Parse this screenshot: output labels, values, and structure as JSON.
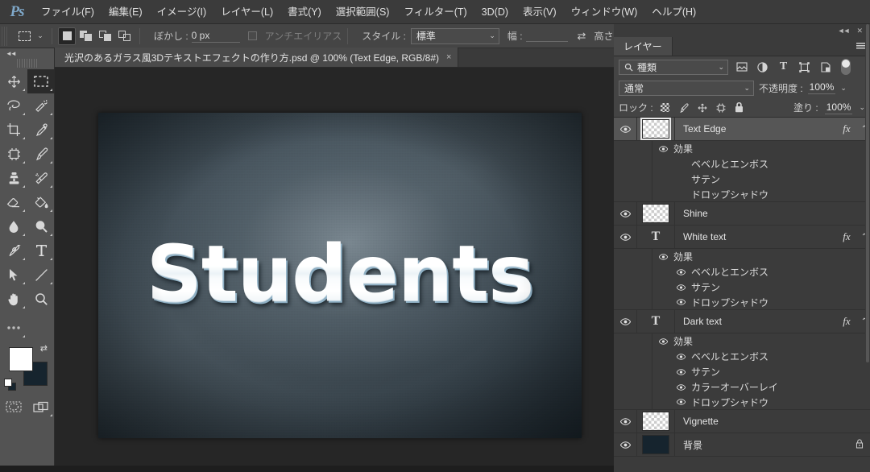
{
  "app": {
    "logo": "Ps"
  },
  "menubar": {
    "items": [
      {
        "label": "ファイル(F)"
      },
      {
        "label": "編集(E)"
      },
      {
        "label": "イメージ(I)"
      },
      {
        "label": "レイヤー(L)"
      },
      {
        "label": "書式(Y)"
      },
      {
        "label": "選択範囲(S)"
      },
      {
        "label": "フィルター(T)"
      },
      {
        "label": "3D(D)"
      },
      {
        "label": "表示(V)"
      },
      {
        "label": "ウィンドウ(W)"
      },
      {
        "label": "ヘルプ(H)"
      }
    ]
  },
  "options": {
    "tool_icon": "rectangular-marquee-icon",
    "feather_label": "ぼかし :",
    "feather_value": "0 px",
    "antialias_label": "アンチエイリアス",
    "antialias_checked": false,
    "style_label": "スタイル :",
    "style_value": "標準",
    "width_label": "幅 :",
    "width_value": "",
    "height_label": "高さ :",
    "height_value": "",
    "swap_icon": "swap-width-height-icon"
  },
  "document": {
    "tab_title": "光沢のあるガラス風3Dテキストエフェクトの作り方.psd @ 100% (Text Edge, RGB/8#)",
    "close_glyph": "×",
    "artwork_text": "Students"
  },
  "toolbar": {
    "tools": [
      {
        "name": "move-tool",
        "selected": false
      },
      {
        "name": "rectangular-marquee-tool",
        "selected": true
      },
      {
        "name": "lasso-tool",
        "selected": false
      },
      {
        "name": "quick-selection-tool",
        "selected": false
      },
      {
        "name": "crop-tool",
        "selected": false
      },
      {
        "name": "eyedropper-tool",
        "selected": false
      },
      {
        "name": "frame-tool",
        "selected": false
      },
      {
        "name": "brush-tool",
        "selected": false
      },
      {
        "name": "clone-stamp-tool",
        "selected": false
      },
      {
        "name": "healing-brush-tool",
        "selected": false
      },
      {
        "name": "eraser-tool",
        "selected": false
      },
      {
        "name": "paint-bucket-tool",
        "selected": false
      },
      {
        "name": "blur-tool",
        "selected": false
      },
      {
        "name": "dodge-tool",
        "selected": false
      },
      {
        "name": "pen-tool",
        "selected": false
      },
      {
        "name": "type-tool",
        "selected": false
      },
      {
        "name": "path-selection-tool",
        "selected": false
      },
      {
        "name": "line-tool",
        "selected": false
      },
      {
        "name": "hand-tool",
        "selected": false
      },
      {
        "name": "zoom-tool",
        "selected": false
      },
      {
        "name": "edit-toolbar-tool",
        "selected": false
      }
    ],
    "foreground_color": "#ffffff",
    "background_color": "#16242e",
    "quickmask_name": "quick-mask-mode",
    "screenmode_name": "screen-mode"
  },
  "panel": {
    "tab_label": "レイヤー",
    "collapse_glyph": "◄◄",
    "close_glyph": "✕",
    "filter": {
      "kind_label": "種類",
      "icons": [
        "pixel-filter-icon",
        "adjustment-filter-icon",
        "type-filter-icon",
        "shape-filter-icon",
        "smartobject-filter-icon"
      ],
      "toggle_name": "filter-enable-toggle"
    },
    "blend_mode": "通常",
    "opacity_label": "不透明度 :",
    "opacity_value": "100%",
    "lock_label": "ロック :",
    "lock_icons": [
      "lock-transparent-pixels-icon",
      "lock-image-pixels-icon",
      "lock-position-icon",
      "lock-artboard-nesting-icon",
      "lock-all-icon"
    ],
    "fill_label": "塗り :",
    "fill_value": "100%",
    "effects_group_label": "効果"
  },
  "layers": [
    {
      "name": "Text Edge",
      "visible": true,
      "selected": true,
      "kind": "pixel",
      "has_fx": true,
      "fx_glyph": "fx",
      "expanded": true,
      "effects_label": "効果",
      "effects": [
        {
          "label": "ベベルとエンボス",
          "visible": false
        },
        {
          "label": "サテン",
          "visible": false
        },
        {
          "label": "ドロップシャドウ",
          "visible": false
        }
      ]
    },
    {
      "name": "Shine",
      "visible": true,
      "selected": false,
      "kind": "pixel",
      "has_fx": false,
      "expanded": false,
      "effects": []
    },
    {
      "name": "White text",
      "visible": true,
      "selected": false,
      "kind": "type",
      "type_glyph": "T",
      "has_fx": true,
      "fx_glyph": "fx",
      "expanded": true,
      "effects_label": "効果",
      "effects": [
        {
          "label": "ベベルとエンボス",
          "visible": true
        },
        {
          "label": "サテン",
          "visible": true
        },
        {
          "label": "ドロップシャドウ",
          "visible": true
        }
      ]
    },
    {
      "name": "Dark text",
      "visible": true,
      "selected": false,
      "kind": "type",
      "type_glyph": "T",
      "has_fx": true,
      "fx_glyph": "fx",
      "expanded": true,
      "effects_label": "効果",
      "effects": [
        {
          "label": "ベベルとエンボス",
          "visible": true
        },
        {
          "label": "サテン",
          "visible": true
        },
        {
          "label": "カラーオーバーレイ",
          "visible": true
        },
        {
          "label": "ドロップシャドウ",
          "visible": true
        }
      ]
    },
    {
      "name": "Vignette",
      "visible": true,
      "selected": false,
      "kind": "pixel",
      "has_fx": false,
      "expanded": false,
      "effects": []
    },
    {
      "name": "背景",
      "visible": true,
      "selected": false,
      "kind": "solid",
      "has_fx": false,
      "locked": true,
      "expanded": false,
      "effects": []
    }
  ]
}
